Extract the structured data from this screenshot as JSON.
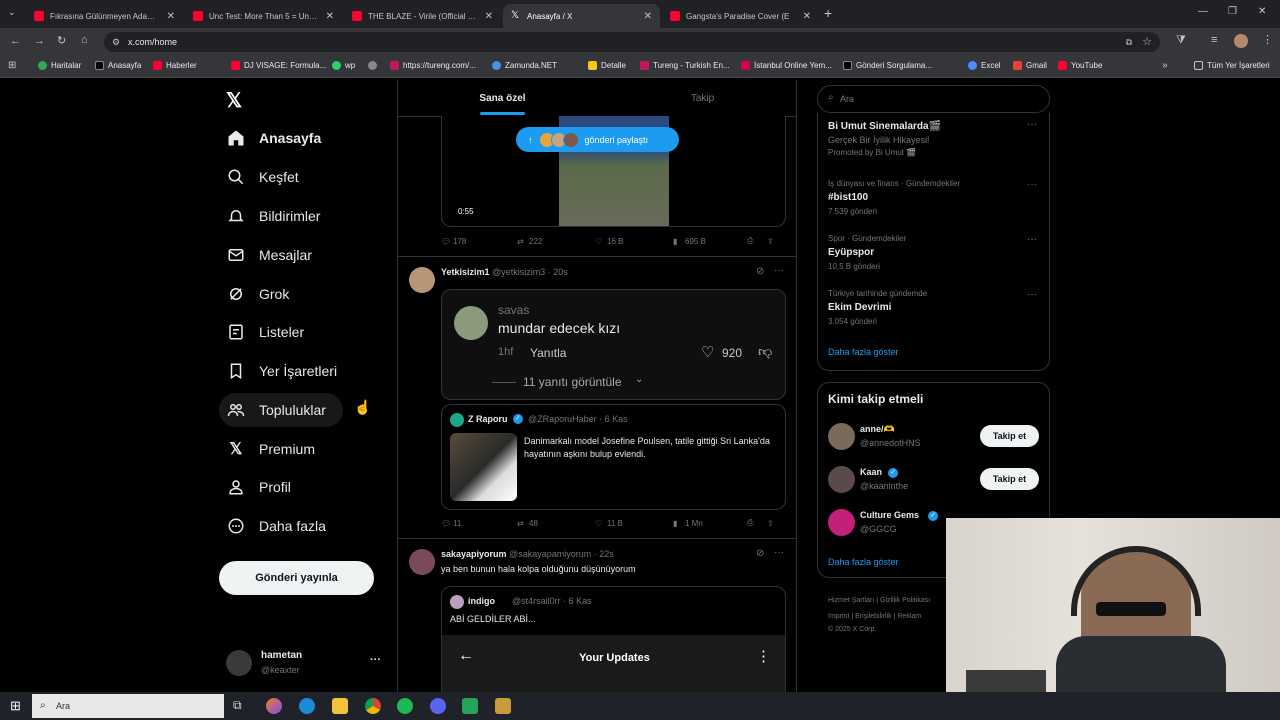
{
  "browser": {
    "tabs": [
      {
        "title": "Fıkrasına Gülünmeyen Adam - f"
      },
      {
        "title": "Unc Test: More Than 5 = Unc St"
      },
      {
        "title": "THE BLAZE - Virile (Official Vide"
      },
      {
        "title": "Anasayfa / X"
      },
      {
        "title": "Gangsta's Paradise Cover (E"
      }
    ],
    "url": "x.com/home",
    "bookmarks": [
      "Haritalar",
      "Anasayfa",
      "Haberler",
      "DJ VISAGE: Formula...",
      "wp",
      "https://tureng.com/...",
      "Zamunda.NET",
      "Detalle",
      "Tureng - Turkish En...",
      "İstanbul Online Yem...",
      "Gönderi Sorgulama...",
      "Excel",
      "Gmail",
      "YouTube",
      "Tüm Yer İşaretleri"
    ]
  },
  "nav": {
    "items": [
      "Anasayfa",
      "Keşfet",
      "Bildirimler",
      "Mesajlar",
      "Grok",
      "Listeler",
      "Yer İşaretleri",
      "Topluluklar",
      "Premium",
      "Profil",
      "Daha fazla"
    ],
    "post_button": "Gönderi yayınla",
    "account_name": "hametan",
    "account_handle": "@keaxter",
    "more": "···"
  },
  "timeline": {
    "tab_for_you": "Sana özel",
    "tab_following": "Takip",
    "new_posts_pill": "gönderi paylaştı",
    "video_time": "0:55",
    "post0_stats": {
      "replies": "178",
      "reposts": "222",
      "likes": "16 B",
      "views": "695 B"
    },
    "post1": {
      "name": "Yetkisizim1",
      "handle_time": "@yetkisizim3 · 20s",
      "comment_user": "savas",
      "comment_text": "mundar edecek kızı",
      "comment_time": "1hf",
      "reply_label": "Yanıtla",
      "comment_likes": "920",
      "view_replies": "11 yanıtı görüntüle",
      "quote_name": "Z Raporu",
      "quote_handle": "@ZRaporuHaber · 6 Kas",
      "quote_text": "Danimarkalı model Josefine Poulsen, tatile gittiği Sri Lanka'da hayatının aşkını bulup evlendi.",
      "stats": {
        "replies": "11",
        "reposts": "48",
        "likes": "11 B",
        "views": "1 Mn"
      }
    },
    "post2": {
      "name": "sakayapiyorum",
      "handle_time": "@sakayapamiyorum · 22s",
      "text": "ya ben bunun hala kolpa olduğunu düşünüyorum",
      "quote_name": "indigo",
      "quote_handle": "@st4rsail0rr · 6 Kas",
      "quote_text": "ABİ GELDİLER ABİ...",
      "media_title": "Your Updates"
    }
  },
  "right": {
    "search_placeholder": "Ara",
    "trends": [
      {
        "title": "Bi Umut Sinemalarda🎬",
        "sub": "Gerçek Bir İyilik Hikayesi!",
        "meta": "Promoted by Bi Umut 🎬"
      },
      {
        "meta": "İş dünyası ve finans · Gündemdekiler",
        "title": "#bist100",
        "sub": "7.539 gönderi"
      },
      {
        "meta": "Spor · Gündemdekiler",
        "title": "Eyüpspor",
        "sub": "10,5 B gönderi"
      },
      {
        "meta": "Türkiye tarihinde gündemde",
        "title": "Ekim Devrimi",
        "sub": "3.054 gönderi"
      }
    ],
    "show_more": "Daha fazla göster",
    "who_to_follow_title": "Kimi takip etmeli",
    "who": [
      {
        "name": "anne/🫶",
        "handle": "@annedotHNS",
        "btn": "Takip et"
      },
      {
        "name": "Kaan",
        "handle": "@kaaninthe",
        "btn": "Takip et"
      },
      {
        "name": "Culture Gems",
        "handle": "@GGCG",
        "btn": "Takip et"
      }
    ],
    "show_more2": "Daha fazla göster",
    "footer1": "Hizmet Şartları | Gizlilik Politikası",
    "footer2": "Imprint | Erişilebilirlik | Reklam",
    "footer3": "© 2025 X Corp."
  },
  "taskbar": {
    "search": "Ara"
  }
}
